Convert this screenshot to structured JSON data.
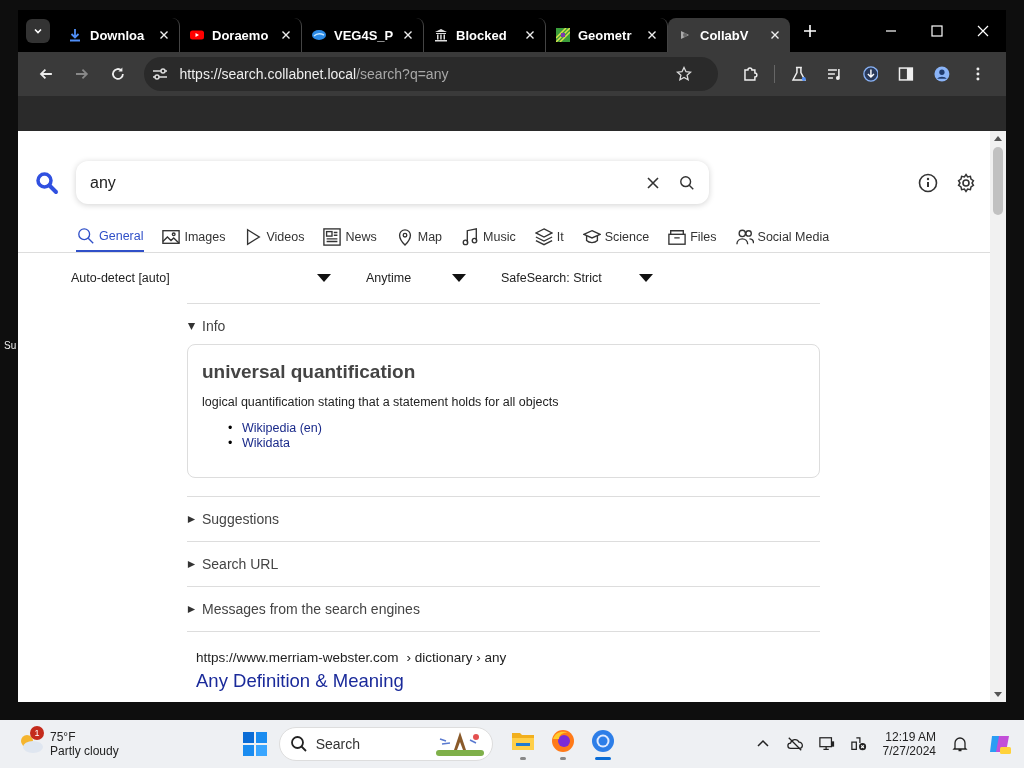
{
  "desktop": {
    "label": "Su"
  },
  "browser": {
    "tabs": [
      {
        "title": "Downloa",
        "kind": "download",
        "selected": false
      },
      {
        "title": "Doraemo",
        "kind": "video",
        "selected": false
      },
      {
        "title": "VEG4S_P",
        "kind": "wave",
        "selected": false
      },
      {
        "title": "Blocked",
        "kind": "building",
        "selected": false
      },
      {
        "title": "Geometr",
        "kind": "game",
        "selected": false
      },
      {
        "title": "CollabV",
        "kind": "site",
        "selected": true
      }
    ],
    "url_host": "https://search.collabnet.local",
    "url_path": "/search?q=any"
  },
  "search": {
    "value": "any"
  },
  "categories": [
    {
      "label": "General",
      "kind": "search",
      "selected": true
    },
    {
      "label": "Images",
      "kind": "image",
      "selected": false
    },
    {
      "label": "Videos",
      "kind": "play",
      "selected": false
    },
    {
      "label": "News",
      "kind": "news",
      "selected": false
    },
    {
      "label": "Map",
      "kind": "pin",
      "selected": false
    },
    {
      "label": "Music",
      "kind": "music",
      "selected": false
    },
    {
      "label": "It",
      "kind": "layers",
      "selected": false
    },
    {
      "label": "Science",
      "kind": "cap",
      "selected": false
    },
    {
      "label": "Files",
      "kind": "files",
      "selected": false
    },
    {
      "label": "Social Media",
      "kind": "people",
      "selected": false
    }
  ],
  "filters": [
    {
      "label": "Auto-detect [auto]"
    },
    {
      "label": "Anytime"
    },
    {
      "label": "SafeSearch: Strict"
    }
  ],
  "info": {
    "label": "Info",
    "expanded": true,
    "title": "universal quantification",
    "description": "logical quantification stating that a statement holds for all objects",
    "links": [
      {
        "marker": "•",
        "label": "Wikipedia (en)"
      },
      {
        "marker": "•",
        "label": "Wikidata"
      }
    ]
  },
  "sections": [
    {
      "label": "Suggestions",
      "expanded": false
    },
    {
      "label": "Search URL",
      "expanded": false
    },
    {
      "label": "Messages from the search engines",
      "expanded": false
    }
  ],
  "result": {
    "url": "https://www.merriam-webster.com",
    "breadcrumb": "› dictionary › any",
    "title": "Any Definition & Meaning"
  },
  "taskbar": {
    "weather": {
      "badge": "1",
      "temperature": "75°F",
      "condition": "Partly cloudy"
    },
    "search": {
      "placeholder": "Search"
    },
    "apps": [
      {
        "kind": "files",
        "active": false
      },
      {
        "kind": "firefox",
        "active": false
      },
      {
        "kind": "chrome",
        "active": true
      }
    ],
    "clock": {
      "time": "12:19 AM",
      "date": "7/27/2024"
    }
  }
}
